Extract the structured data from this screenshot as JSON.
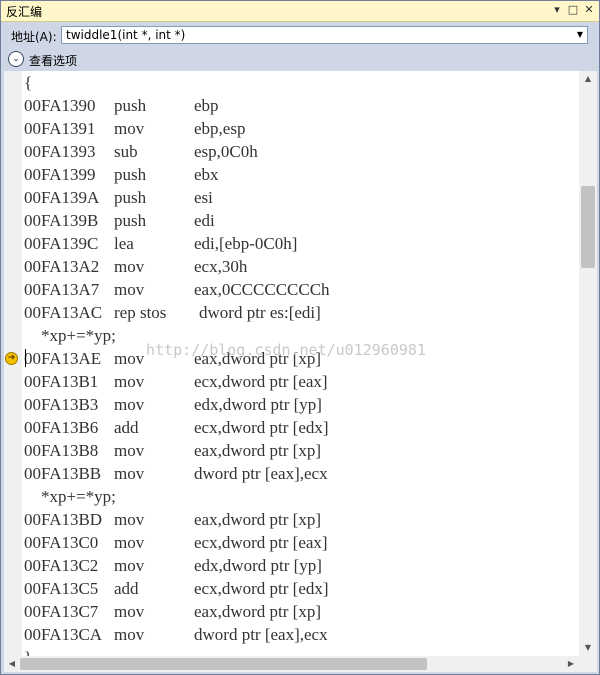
{
  "window": {
    "title": "反汇编",
    "pin_glyph": "▾",
    "maximize_glyph": "□",
    "close_glyph": "✕"
  },
  "toolbar": {
    "address_label": "地址(A):",
    "address_value": "twiddle1(int *, int *)",
    "dropdown_glyph": "▼"
  },
  "options": {
    "label": "查看选项",
    "toggle_glyph": "⌄"
  },
  "watermark": "http://blog.csdn.net/u012960981",
  "disassembly": [
    {
      "addr": "{",
      "op": "",
      "args": ""
    },
    {
      "addr": "00FA1390",
      "op": "push",
      "args": "ebp"
    },
    {
      "addr": "00FA1391",
      "op": "mov",
      "args": "ebp,esp"
    },
    {
      "addr": "00FA1393",
      "op": "sub",
      "args": "esp,0C0h"
    },
    {
      "addr": "00FA1399",
      "op": "push",
      "args": "ebx"
    },
    {
      "addr": "00FA139A",
      "op": "push",
      "args": "esi"
    },
    {
      "addr": "00FA139B",
      "op": "push",
      "args": "edi"
    },
    {
      "addr": "00FA139C",
      "op": "lea",
      "args": "edi,[ebp-0C0h]"
    },
    {
      "addr": "00FA13A2",
      "op": "mov",
      "args": "ecx,30h"
    },
    {
      "addr": "00FA13A7",
      "op": "mov",
      "args": "eax,0CCCCCCCCh"
    },
    {
      "addr": "00FA13AC",
      "op": "rep stos",
      "args": "dword ptr es:[edi]"
    },
    {
      "addr": "    *xp+=*yp;",
      "op": "",
      "args": ""
    },
    {
      "addr": "00FA13AE",
      "op": "mov",
      "args": "eax,dword ptr [xp]",
      "current": true
    },
    {
      "addr": "00FA13B1",
      "op": "mov",
      "args": "ecx,dword ptr [eax]"
    },
    {
      "addr": "00FA13B3",
      "op": "mov",
      "args": "edx,dword ptr [yp]"
    },
    {
      "addr": "00FA13B6",
      "op": "add",
      "args": "ecx,dword ptr [edx]"
    },
    {
      "addr": "00FA13B8",
      "op": "mov",
      "args": "eax,dword ptr [xp]"
    },
    {
      "addr": "00FA13BB",
      "op": "mov",
      "args": "dword ptr [eax],ecx"
    },
    {
      "addr": "    *xp+=*yp;",
      "op": "",
      "args": ""
    },
    {
      "addr": "00FA13BD",
      "op": "mov",
      "args": "eax,dword ptr [xp]"
    },
    {
      "addr": "00FA13C0",
      "op": "mov",
      "args": "ecx,dword ptr [eax]"
    },
    {
      "addr": "00FA13C2",
      "op": "mov",
      "args": "edx,dword ptr [yp]"
    },
    {
      "addr": "00FA13C5",
      "op": "add",
      "args": "ecx,dword ptr [edx]"
    },
    {
      "addr": "00FA13C7",
      "op": "mov",
      "args": "eax,dword ptr [xp]"
    },
    {
      "addr": "00FA13CA",
      "op": "mov",
      "args": "dword ptr [eax],ecx"
    },
    {
      "addr": "}",
      "op": "",
      "args": ""
    }
  ],
  "colors": {
    "title_bar": "#fff7c9",
    "chrome": "#cfd6e5",
    "code_text": "#333333",
    "arrow": "#f2c200"
  },
  "icons": {
    "current_line": "next-statement-arrow-icon"
  }
}
